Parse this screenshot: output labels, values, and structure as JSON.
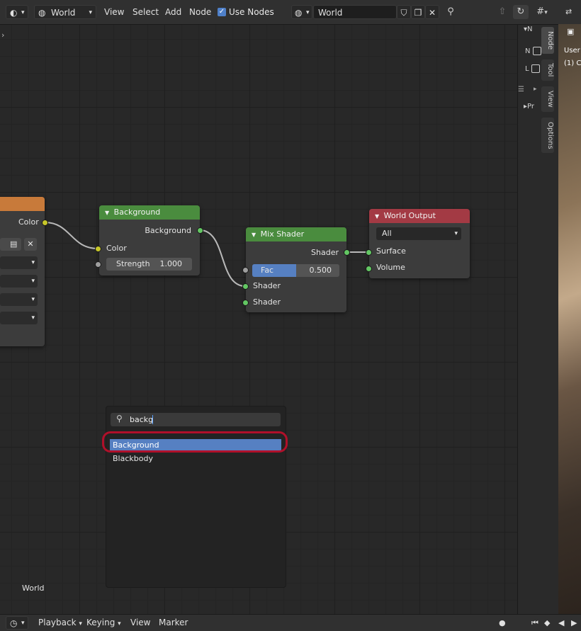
{
  "header": {
    "editor_type_icon": "node-editor-icon",
    "shader_type_icon": "world-icon",
    "shader_type": "World",
    "menus": [
      "View",
      "Select",
      "Add",
      "Node"
    ],
    "use_nodes_label": "Use Nodes",
    "use_nodes_checked": true,
    "world_browse_icon": "world-icon",
    "world_name": "World"
  },
  "nodes": {
    "partial": {
      "output_label": "Color"
    },
    "background": {
      "title": "Background",
      "output_label": "Background",
      "input_color": "Color",
      "strength_label": "Strength",
      "strength_value": "1.000"
    },
    "mix_shader": {
      "title": "Mix Shader",
      "output_label": "Shader",
      "fac_label": "Fac",
      "fac_value": "0.500",
      "fac_fraction": 0.5,
      "input1": "Shader",
      "input2": "Shader"
    },
    "world_output": {
      "title": "World Output",
      "target": "All",
      "input_surface": "Surface",
      "input_volume": "Volume"
    }
  },
  "search": {
    "query": "backg",
    "results": [
      "Background",
      "Blackbody"
    ],
    "highlighted": "Background"
  },
  "canvas_label": "World",
  "sidebar": {
    "tabs": [
      "Node",
      "Tool",
      "View",
      "Options"
    ],
    "items": [
      "N",
      "N",
      "L",
      "Pr"
    ]
  },
  "viewport": {
    "label1": "User",
    "label2": "(1) C"
  },
  "footer": {
    "menus": [
      "Playback",
      "Keying",
      "View",
      "Marker"
    ]
  },
  "colors": {
    "header_green": "#4a8c3e",
    "header_red": "#a33a44",
    "header_orange": "#c87a3a",
    "highlight_blue": "#5680c2",
    "annotation_red": "#b0102a"
  }
}
